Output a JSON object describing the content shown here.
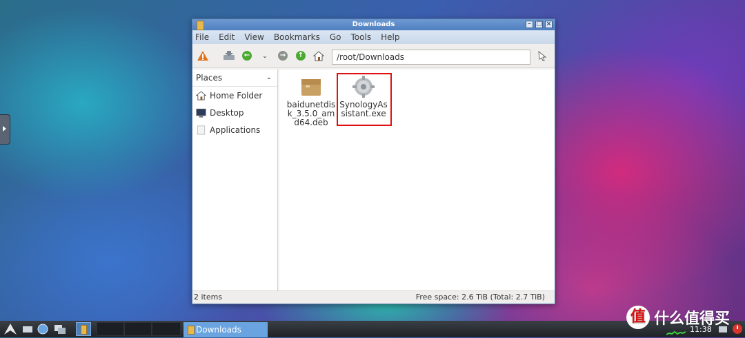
{
  "window": {
    "title": "Downloads",
    "menu": [
      "File",
      "Edit",
      "View",
      "Bookmarks",
      "Go",
      "Tools",
      "Help"
    ],
    "location": "/root/Downloads"
  },
  "sidebar": {
    "header": "Places",
    "items": [
      {
        "label": "Home Folder",
        "icon": "home-icon"
      },
      {
        "label": "Desktop",
        "icon": "desktop-icon"
      },
      {
        "label": "Applications",
        "icon": "applications-icon"
      }
    ]
  },
  "files": [
    {
      "name": "baidunetdisk_3.5.0_amd64.deb",
      "icon": "package-icon"
    },
    {
      "name": "SynologyAssistant.exe",
      "icon": "exe-gear-icon",
      "highlighted": true
    }
  ],
  "status": {
    "items": "2 items",
    "free_space": "Free space: 2.6 TiB (Total: 2.7 TiB)"
  },
  "taskbar": {
    "task_label": "Downloads",
    "clock": "11:38"
  },
  "watermark": {
    "text": "什么值得买",
    "logo": "值"
  },
  "colors": {
    "titlebar": "#5a88c8",
    "highlight_box": "#e01010",
    "task_active": "#6aa4e0"
  }
}
